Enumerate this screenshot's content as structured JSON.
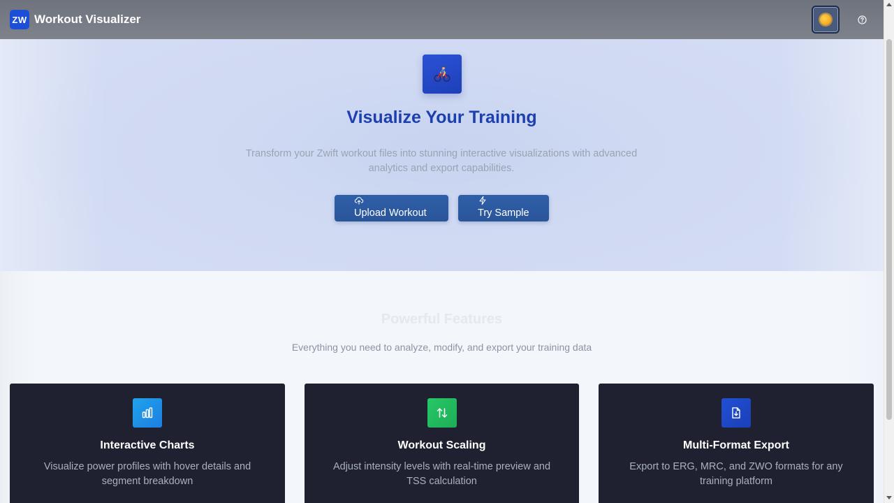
{
  "header": {
    "brand_badge": "ZW",
    "title": "Workout Visualizer",
    "theme_icon": "sun-icon",
    "help_icon": "help-circle-icon"
  },
  "hero": {
    "icon": "cyclist-icon",
    "title": "Visualize Your Training",
    "subtitle": "Transform your Zwift workout files into stunning interactive visualizations with advanced analytics and export capabilities.",
    "upload_button": {
      "label": "Upload Workout",
      "icon": "upload-cloud-icon"
    },
    "sample_button": {
      "label": "Try Sample",
      "icon": "lightning-icon"
    }
  },
  "features": {
    "title": "Powerful Features",
    "subtitle": "Everything you need to analyze, modify, and export your training data",
    "cards": [
      {
        "title": "Interactive Charts",
        "description": "Visualize power profiles with hover details and segment breakdown",
        "icon": "bar-chart-icon",
        "color": "#1e90e6"
      },
      {
        "title": "Workout Scaling",
        "description": "Adjust intensity levels with real-time preview and TSS calculation",
        "icon": "arrows-up-down-icon",
        "color": "#22c060"
      },
      {
        "title": "Multi-Format Export",
        "description": "Export to ERG, MRC, and ZWO formats for any training platform",
        "icon": "file-download-icon",
        "color": "#1d47c8"
      }
    ]
  },
  "colors": {
    "accent": "#1e40af",
    "card_background": "#1f2130",
    "button": "#2c5aa0"
  }
}
